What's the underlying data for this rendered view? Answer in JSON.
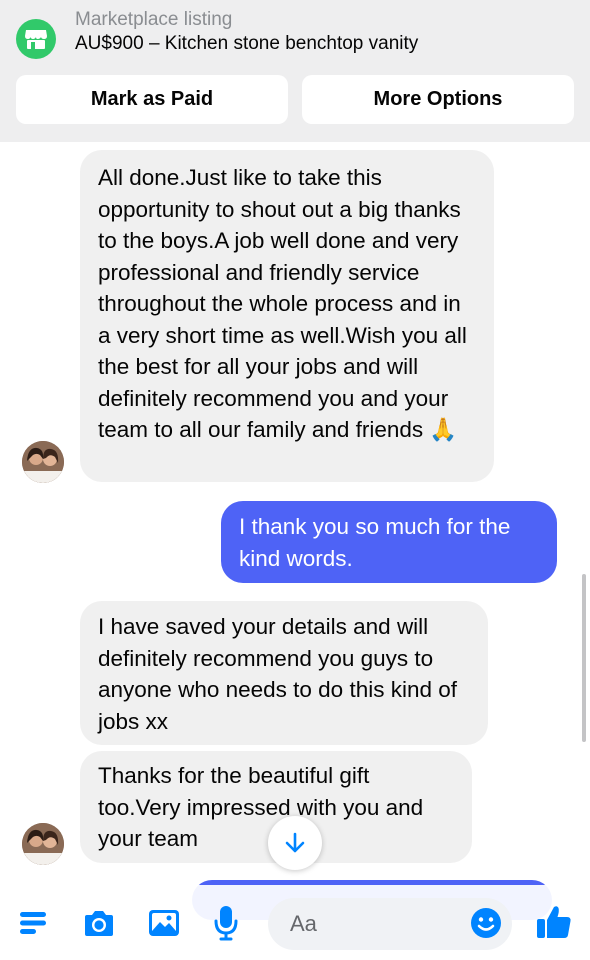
{
  "listing": {
    "label": "Marketplace listing",
    "title": "AU$900 – Kitchen stone benchtop vanity",
    "icon": "marketplace-store-icon"
  },
  "actions": {
    "mark_paid": "Mark as Paid",
    "more_options": "More Options"
  },
  "messages": [
    {
      "direction": "incoming",
      "text": "All done.Just like to take this opportunity to shout out a big thanks to the boys.A job well done and very professional and friendly service throughout the whole process and in a very short time as well.Wish you all the best for all your jobs and will definitely recommend you and your team to all our family and friends 🙏"
    },
    {
      "direction": "outgoing",
      "text": "I thank you so much for the kind words."
    },
    {
      "direction": "incoming",
      "text": "I have saved your details and will definitely recommend you guys to anyone who needs to do this kind of jobs xx"
    },
    {
      "direction": "incoming",
      "text": "Thanks for the beautiful gift too.Very impressed with you and your team"
    },
    {
      "direction": "outgoing",
      "text": ""
    }
  ],
  "composer": {
    "placeholder": "Aa",
    "icons": [
      "menu-icon",
      "camera-icon",
      "photo-icon",
      "microphone-icon",
      "emoji-icon",
      "thumbs-up-icon"
    ]
  },
  "colors": {
    "accent": "#0084ff",
    "outgoing_bubble": "#4e63f6",
    "incoming_bubble": "#f0f0f0",
    "marketplace_green": "#31c96a",
    "header_bg": "#eeeeef"
  }
}
